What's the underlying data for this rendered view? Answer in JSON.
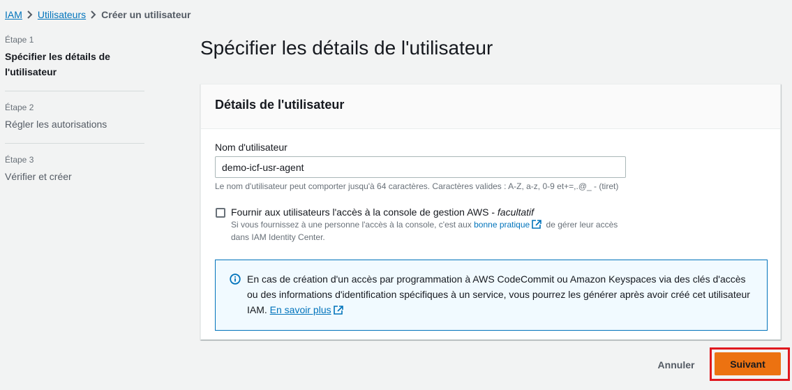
{
  "breadcrumb": {
    "items": [
      "IAM",
      "Utilisateurs"
    ],
    "current": "Créer un utilisateur"
  },
  "steps": [
    {
      "num": "Étape 1",
      "title": "Spécifier les détails de l'utilisateur",
      "active": true
    },
    {
      "num": "Étape 2",
      "title": "Régler les autorisations",
      "active": false
    },
    {
      "num": "Étape 3",
      "title": "Vérifier et créer",
      "active": false
    }
  ],
  "page": {
    "title": "Spécifier les détails de l'utilisateur"
  },
  "panel": {
    "header": "Détails de l'utilisateur",
    "username_label": "Nom d'utilisateur",
    "username_value": "demo-icf-usr-agent",
    "username_hint": "Le nom d'utilisateur peut comporter jusqu'à 64 caractères. Caractères valides : A-Z, a-z, 0-9 et+=,.@_ - (tiret)",
    "console_access": {
      "label": "Fournir aux utilisateurs l'accès à la console de gestion AWS - ",
      "label_optional": "facultatif",
      "checked": false,
      "desc_before": "Si vous fournissez à une personne l'accès à la console, c'est aux ",
      "desc_link": "bonne pratique",
      "desc_after": " de gérer leur accès dans IAM Identity Center."
    },
    "info": {
      "text": "En cas de création d'un accès par programmation à AWS CodeCommit ou Amazon Keyspaces via des clés d'accès ou des informations d'identification spécifiques à un service, vous pourrez les générer après avoir créé cet utilisateur IAM. ",
      "link": "En savoir plus"
    }
  },
  "footer": {
    "cancel": "Annuler",
    "next": "Suivant"
  },
  "colors": {
    "accent": "#ec7211",
    "link": "#0073bb",
    "highlight": "#e0181e"
  },
  "icons": [
    "chevron-right-icon",
    "external-link-icon",
    "info-icon"
  ]
}
